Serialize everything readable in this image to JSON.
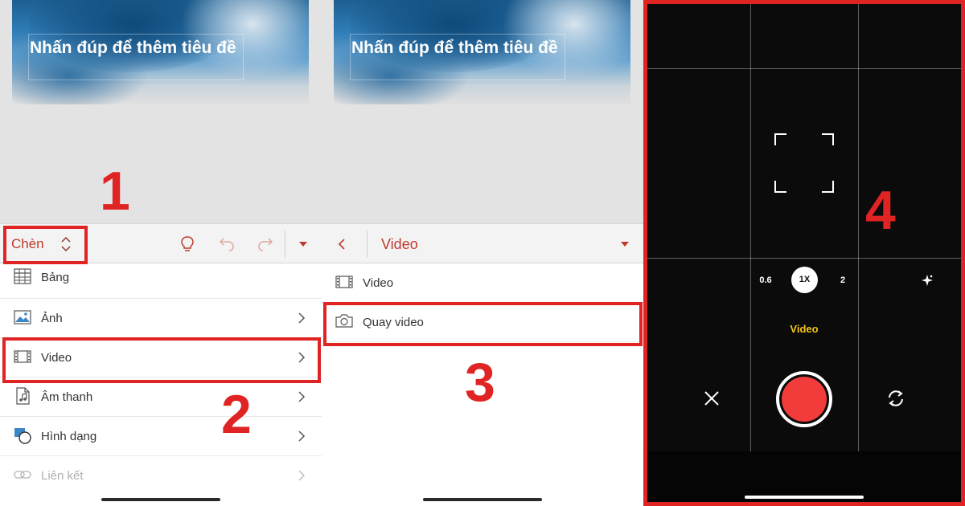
{
  "slides": [
    {
      "title": "Nhấn đúp để thêm tiêu đề"
    },
    {
      "title": "Nhấn đúp để thêm tiêu đề"
    }
  ],
  "left_panel": {
    "toolbar": {
      "tab_label": "Chèn",
      "icons": [
        "lightbulb-icon",
        "undo-icon",
        "redo-icon",
        "caret-down-icon"
      ]
    },
    "menu": [
      {
        "label": "Bảng",
        "icon": "table-icon",
        "has_chevron": false,
        "enabled": true
      },
      {
        "label": "Ảnh",
        "icon": "image-icon",
        "has_chevron": true,
        "enabled": true
      },
      {
        "label": "Video",
        "icon": "film-icon",
        "has_chevron": true,
        "enabled": true
      },
      {
        "label": "Âm thanh",
        "icon": "audio-file-icon",
        "has_chevron": true,
        "enabled": true
      },
      {
        "label": "Hình dạng",
        "icon": "shapes-icon",
        "has_chevron": true,
        "enabled": true
      },
      {
        "label": "Liên kết",
        "icon": "link-icon",
        "has_chevron": true,
        "enabled": false
      }
    ]
  },
  "mid_panel": {
    "toolbar": {
      "title": "Video"
    },
    "menu": [
      {
        "label": "Video",
        "icon": "film-icon"
      },
      {
        "label": "Quay video",
        "icon": "camera-icon"
      }
    ]
  },
  "camera": {
    "zoom_levels": [
      "0.6",
      "1X",
      "2"
    ],
    "selected_zoom": "1X",
    "mode_label": "Video"
  },
  "steps": [
    "1",
    "2",
    "3",
    "4"
  ],
  "colors": {
    "accent": "#c0392b",
    "highlight": "#e02323",
    "record": "#f23b3b",
    "mode_text": "#f5c518"
  }
}
